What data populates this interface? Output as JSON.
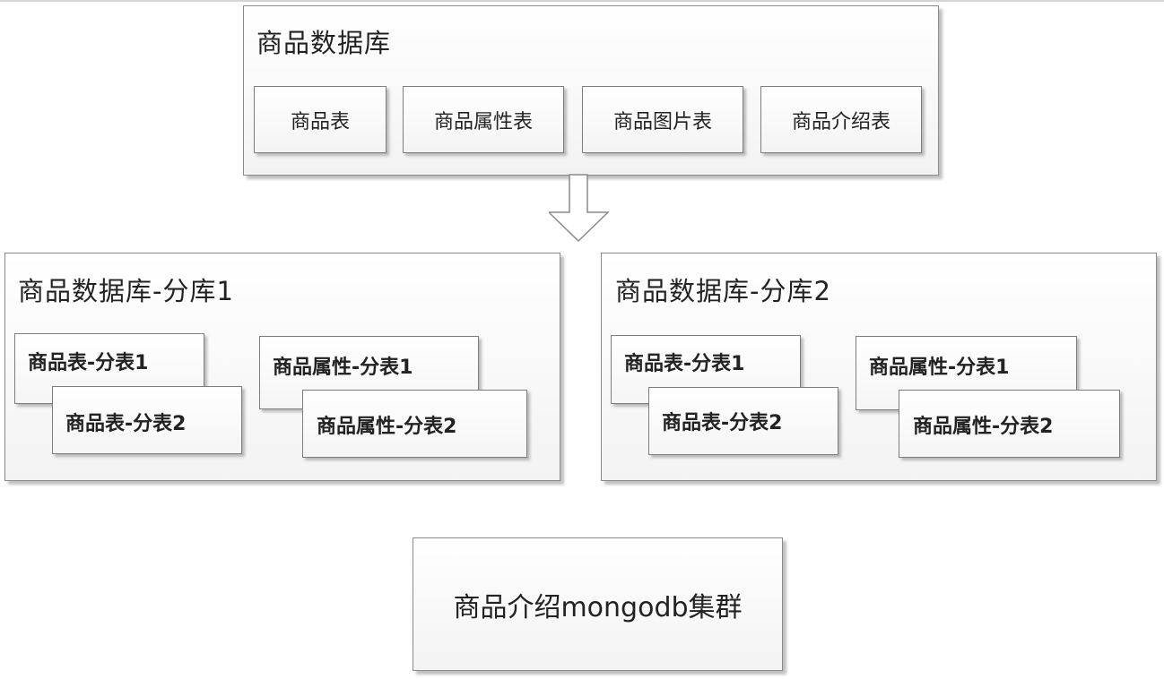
{
  "top_db": {
    "title": "商品数据库",
    "tables": [
      "商品表",
      "商品属性表",
      "商品图片表",
      "商品介绍表"
    ]
  },
  "arrow": {
    "direction": "down"
  },
  "shard_db_1": {
    "title": "商品数据库-分库1",
    "product_table_shards": [
      "商品表-分表1",
      "商品表-分表2"
    ],
    "attribute_table_shards": [
      "商品属性-分表1",
      "商品属性-分表2"
    ]
  },
  "shard_db_2": {
    "title": "商品数据库-分库2",
    "product_table_shards": [
      "商品表-分表1",
      "商品表-分表2"
    ],
    "attribute_table_shards": [
      "商品属性-分表1",
      "商品属性-分表2"
    ]
  },
  "mongodb_cluster": {
    "label": "商品介绍mongodb集群"
  }
}
